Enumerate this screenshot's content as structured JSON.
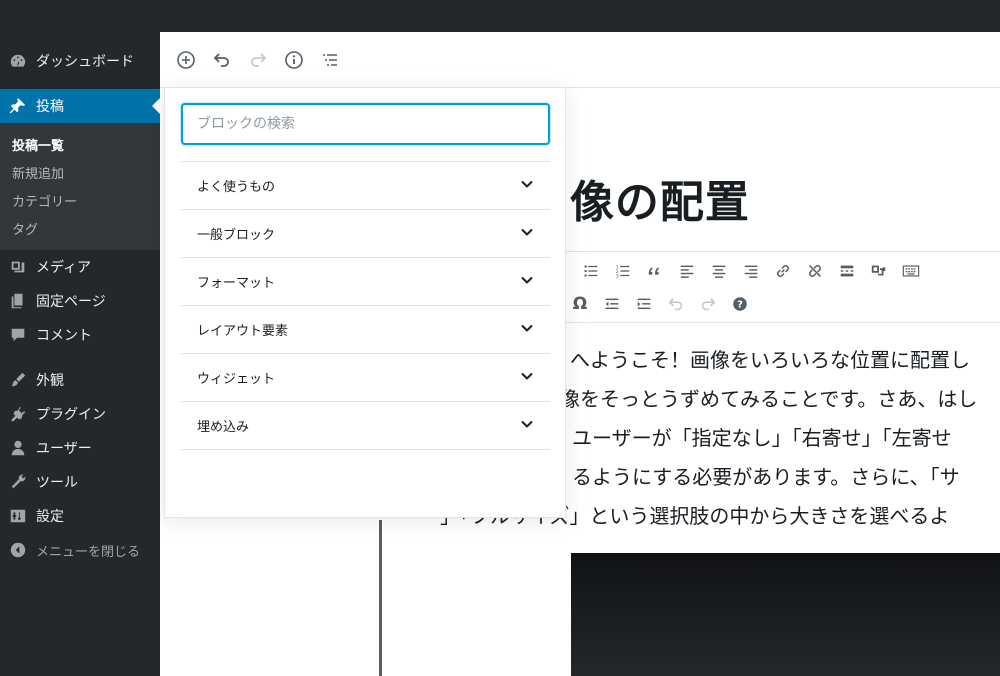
{
  "sidebar": {
    "items": [
      {
        "label": "ダッシュボード",
        "icon": "dashboard-icon"
      },
      {
        "label": "投稿",
        "icon": "pin-icon",
        "active": true
      },
      {
        "label": "メディア",
        "icon": "media-icon"
      },
      {
        "label": "固定ページ",
        "icon": "pages-icon"
      },
      {
        "label": "コメント",
        "icon": "comment-icon"
      },
      {
        "label": "外観",
        "icon": "brush-icon"
      },
      {
        "label": "プラグイン",
        "icon": "plugin-icon"
      },
      {
        "label": "ユーザー",
        "icon": "user-icon"
      },
      {
        "label": "ツール",
        "icon": "wrench-icon"
      },
      {
        "label": "設定",
        "icon": "settings-icon"
      }
    ],
    "submenu": [
      "投稿一覧",
      "新規追加",
      "カテゴリー",
      "タグ"
    ],
    "collapse_label": "メニューを閉じる"
  },
  "header": {
    "buttons": [
      "add-block-icon",
      "undo-icon",
      "redo-icon",
      "info-icon",
      "outline-icon"
    ]
  },
  "inserter": {
    "search_placeholder": "ブロックの検索",
    "panels": [
      "よく使うもの",
      "一般ブロック",
      "フォーマット",
      "レイアウト要素",
      "ウィジェット",
      "埋め込み"
    ]
  },
  "post": {
    "title": "ップ: 画像の配置",
    "paragraph_lines": [
      "へようこそ！画像をいろいろな位置に配置し",
      "像をそっとうずめてみることです。さあ、はし",
      "ユーザーが「指定なし」「右寄せ」「左寄せ",
      "るようにする必要があります。さらに、「サ",
      "」「フルサイズ」という選択肢の中から大きさを選べるよ"
    ]
  },
  "toolbar": {
    "row1": [
      "bulleted-list-icon",
      "numbered-list-icon",
      "quote-icon",
      "align-left-icon",
      "align-center-icon",
      "align-right-icon",
      "link-icon",
      "unlink-icon",
      "read-more-icon",
      "kitchen-sink-icon",
      "keyboard-icon"
    ],
    "row2_omega": "Ω",
    "row2": [
      "outdent-icon",
      "indent-icon",
      "undo-icon",
      "redo-icon",
      "help-icon"
    ]
  },
  "colors": {
    "accent": "#0073aa",
    "focus": "#00a0d2",
    "admin_bg": "#23282d",
    "submenu_bg": "#32373c"
  }
}
